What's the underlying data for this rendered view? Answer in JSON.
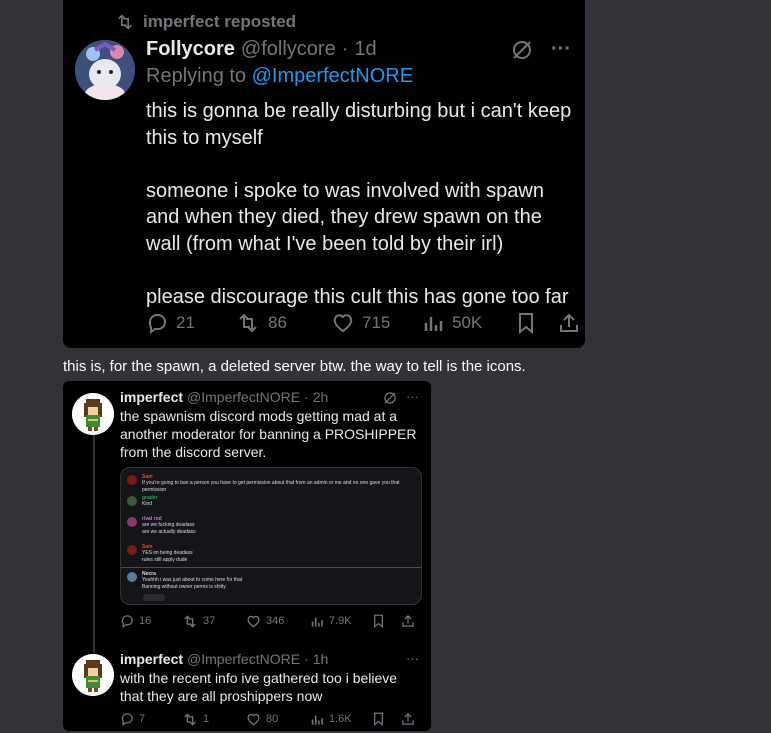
{
  "first_screenshot": {
    "repost_label": "imperfect reposted",
    "tweet": {
      "display_name": "Follycore",
      "handle": "@follycore",
      "separator": "·",
      "time": "1d",
      "replying_prefix": "Replying to",
      "replying_handle": "@ImperfectNORE",
      "text": "this is gonna be really disturbing but i can't keep this to myself\n\nsomeone i spoke to was involved with spawn and when they died, they drew spawn on the wall (from what I've been told by their irl)\n\nplease discourage this cult this has gone too far",
      "more_label": "···",
      "replies": "21",
      "reposts": "86",
      "likes": "715",
      "views": "50K"
    }
  },
  "caption": "this is, for the spawn, a deleted server btw. the way to tell is the icons.",
  "second_screenshot": {
    "tweet1": {
      "display_name": "imperfect",
      "handle": "@ImperfectNORE",
      "separator": "·",
      "time": "2h",
      "text": "the spawnism discord mods getting mad at a another moderator for banning a PROSHIPPER from the discord server.",
      "more_label": "···",
      "replies": "16",
      "reposts": "37",
      "likes": "346",
      "views": "7.9K"
    },
    "embed_messages": [
      {
        "name": "Sam",
        "color": "#f23f43",
        "text": "If you're going to ban a person you have to get permission about that from an admin or me and no one gave you that permission"
      },
      {
        "name": "grader",
        "color": "#23a55a",
        "text": "Kind"
      },
      {
        "name": "rival rod",
        "color": "#c27ce6",
        "text": "are we fucking deadass\nare we actually deadass"
      },
      {
        "name": "Sam",
        "color": "#f23f43",
        "text": "YES im being deadass\nrules still apply dude"
      },
      {
        "name": "Necra",
        "color": "#dbdee1",
        "text": "Yeahhh i was just about to come here for that\nBanning without owner perms is shitty"
      }
    ],
    "tweet2": {
      "display_name": "imperfect",
      "handle": "@ImperfectNORE",
      "separator": "·",
      "time": "1h",
      "text": "with the recent info ive gathered too i believe that they are all proshippers now",
      "more_label": "···",
      "replies": "7",
      "reposts": "1",
      "likes": "80",
      "views": "1.6K"
    }
  },
  "colors": {
    "background": "#313338",
    "tweet_bg": "#000000",
    "muted": "#71767b",
    "link": "#1d9bf0",
    "text": "#e7e9ea"
  }
}
